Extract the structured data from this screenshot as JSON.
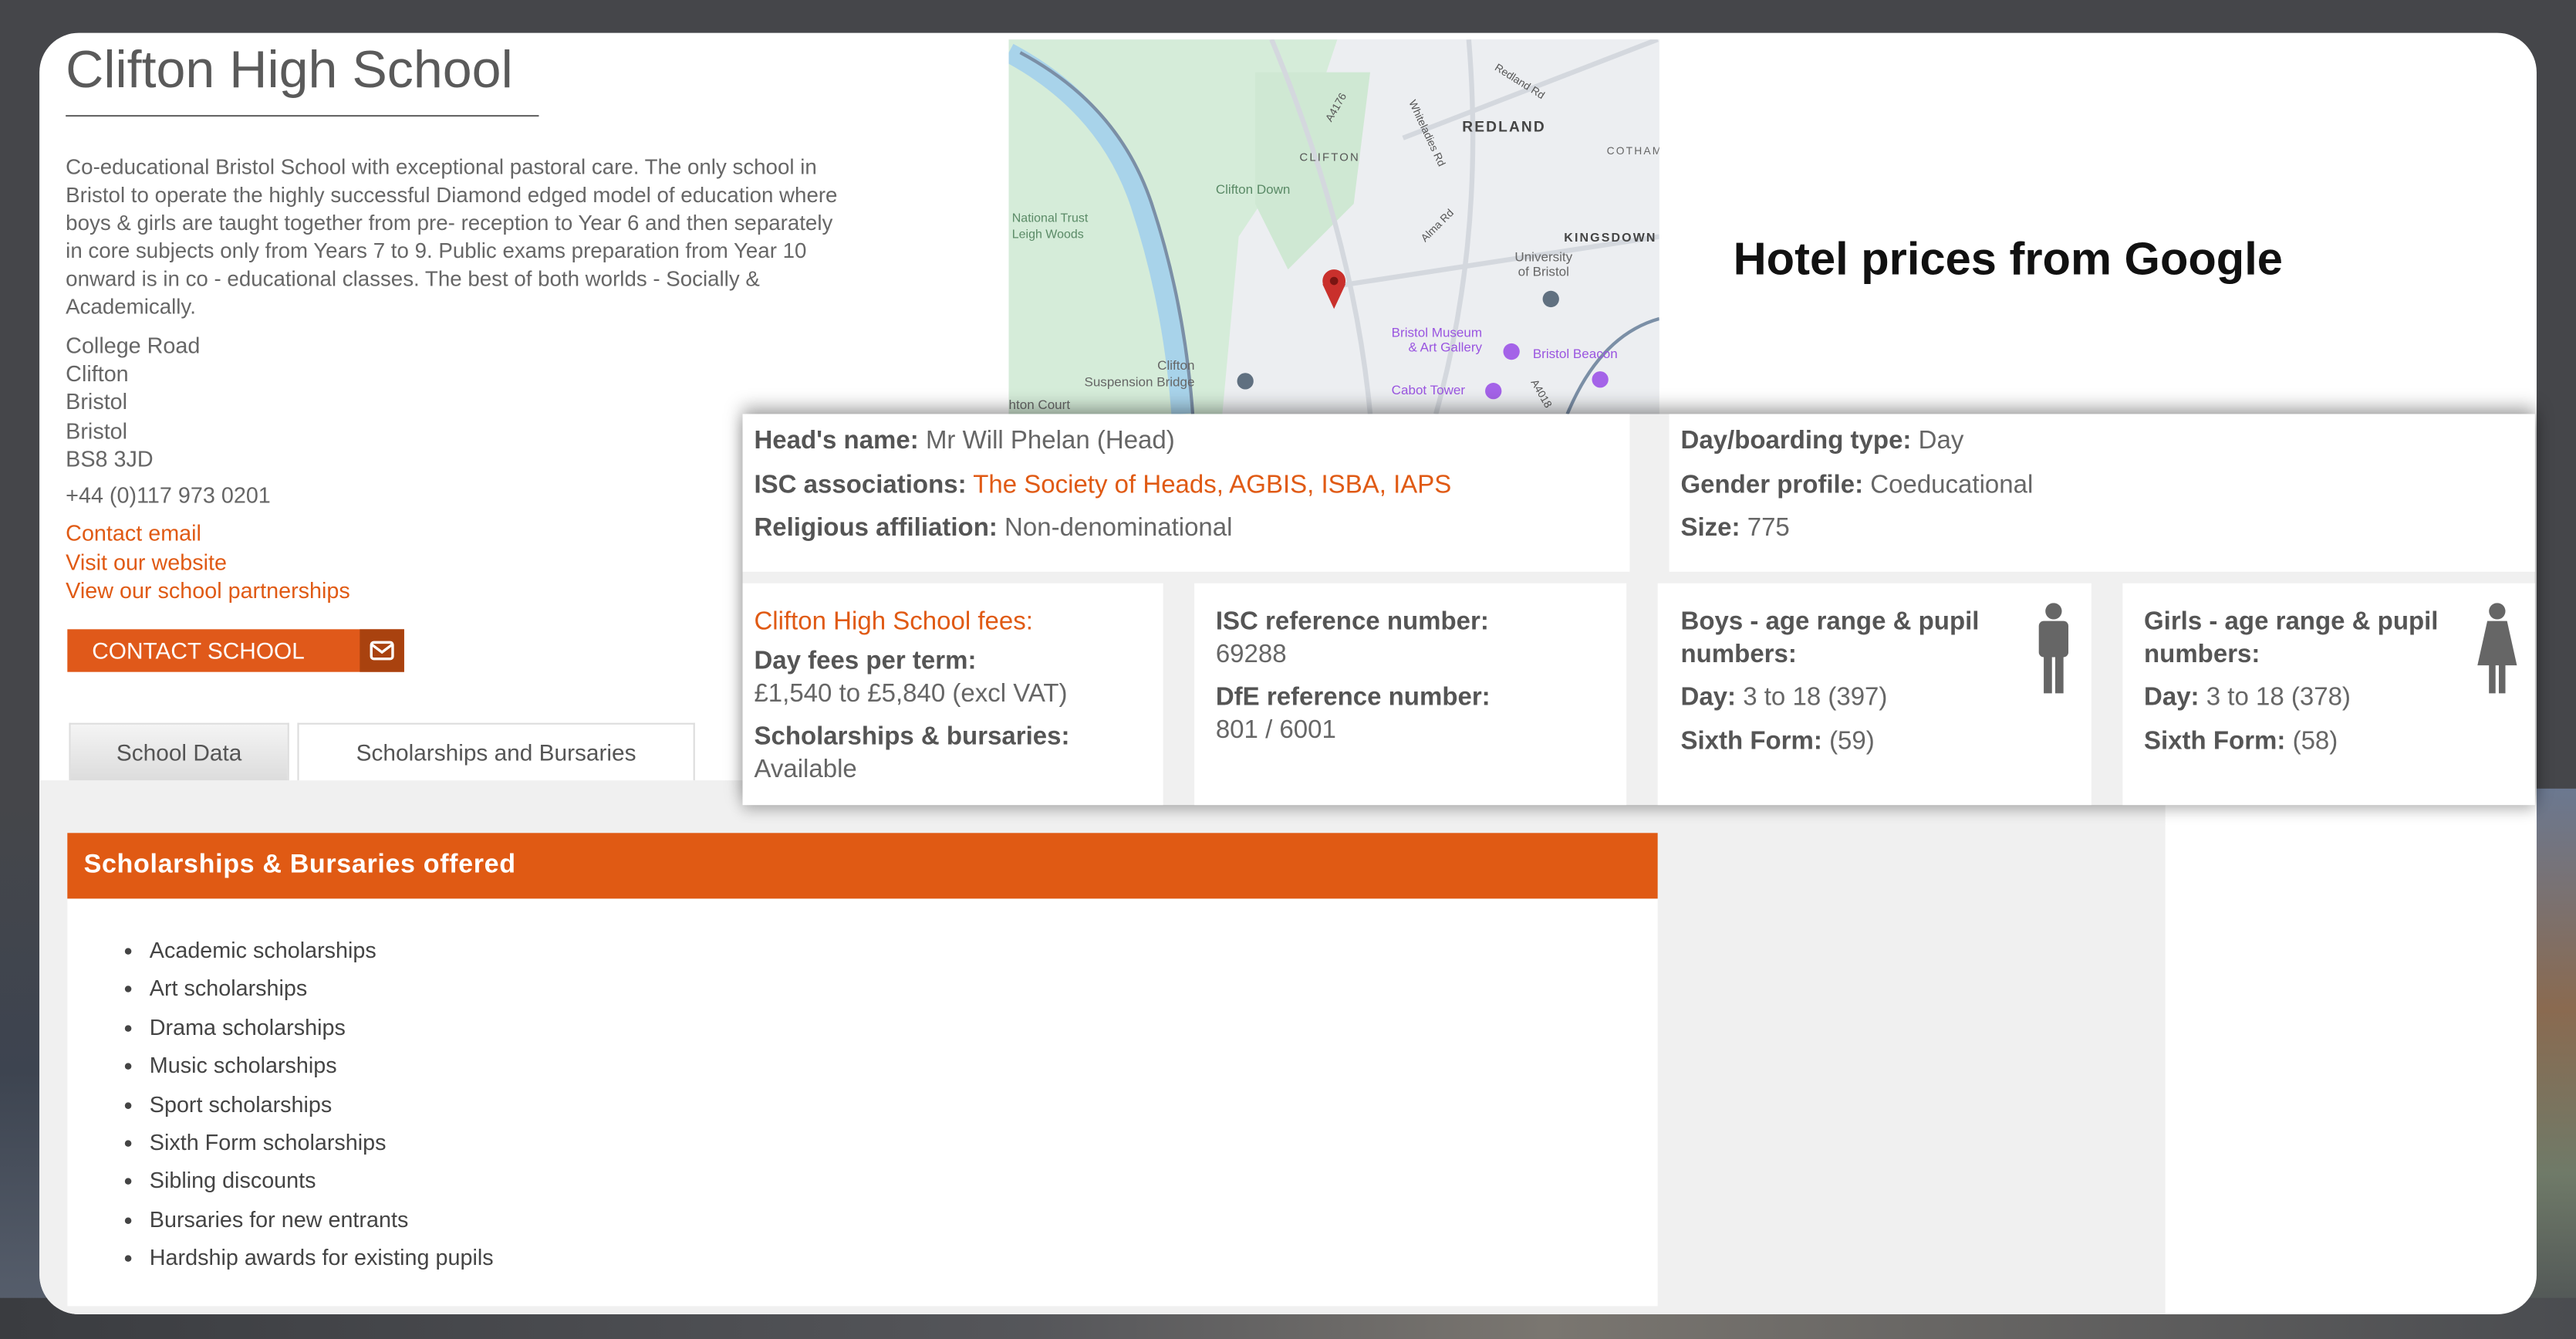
{
  "school": {
    "title": "Clifton High School",
    "description": "Co-educational Bristol School with exceptional pastoral care. The only school in Bristol to operate the highly successful Diamond edged model of education where boys & girls are taught together from pre- reception to Year 6 and then separately in core subjects only from Years 7 to 9. Public exams preparation from Year 10 onward is in co - educational classes. The best of both worlds - Socially & Academically.",
    "address": [
      "College Road",
      "Clifton",
      "Bristol",
      "Bristol",
      "BS8 3JD"
    ],
    "phone": "+44 (0)117 973 0201",
    "links": [
      "Contact email",
      "Visit our website",
      "View our school partnerships"
    ],
    "contact_button": "CONTACT SCHOOL"
  },
  "tabs": [
    {
      "label": "School Data",
      "active": false
    },
    {
      "label": "Scholarships and Bursaries",
      "active": true
    }
  ],
  "offered": {
    "heading": "Scholarships & Bursaries offered",
    "items": [
      "Academic scholarships",
      "Art scholarships",
      "Drama scholarships",
      "Music scholarships",
      "Sport scholarships",
      "Sixth Form scholarships",
      "Sibling discounts",
      "Bursaries for new entrants",
      "Hardship awards for existing pupils"
    ]
  },
  "map": {
    "labels": [
      "REDLAND",
      "CLIFTON",
      "Clifton Down",
      "National Trust",
      "Leigh Woods",
      "KINGSDOWN",
      "University",
      "of Bristol",
      "COTHAM",
      "Bristol Museum",
      "& Art Gallery",
      "Bristol Beacon",
      "Cabot Tower",
      "Clifton",
      "Suspension Bridge",
      "A4176",
      "Alma Rd",
      "Redland Rd",
      "Whiteladies Rd",
      "A4018",
      "hton Court"
    ]
  },
  "overlay_title": "Hotel prices from Google",
  "info": {
    "head_label": "Head's name:",
    "head_value": "Mr Will Phelan (Head)",
    "isc_label": "ISC associations:",
    "isc_value": "The Society of Heads, AGBIS, ISBA, IAPS",
    "religion_label": "Religious affiliation:",
    "religion_value": "Non-denominational",
    "boarding_label": "Day/boarding type:",
    "boarding_value": "Day",
    "gender_label": "Gender profile:",
    "gender_value": "Coeducational",
    "size_label": "Size:",
    "size_value": "775",
    "fees_title": "Clifton High School fees:",
    "dayfees_label": "Day fees per term:",
    "dayfees_value": "£1,540 to £5,840 (excl VAT)",
    "schol_label": "Scholarships & bursaries:",
    "schol_value": "Available",
    "iscref_label": "ISC reference number:",
    "iscref_value": "69288",
    "dfe_label": "DfE reference number:",
    "dfe_value": "801 / 6001",
    "boys_title": "Boys - age range & pupil numbers:",
    "boys_day_label": "Day:",
    "boys_day_value": "3 to 18 (397)",
    "boys_sixth_label": "Sixth Form:",
    "boys_sixth_value": "(59)",
    "girls_title": "Girls - age range & pupil numbers:",
    "girls_day_label": "Day:",
    "girls_day_value": "3 to 18 (378)",
    "girls_sixth_label": "Sixth Form:",
    "girls_sixth_value": "(58)"
  },
  "colors": {
    "accent": "#e05a14",
    "accent_dark": "#a9420f",
    "panel_bg": "#f0f0f0",
    "text": "#666666"
  }
}
